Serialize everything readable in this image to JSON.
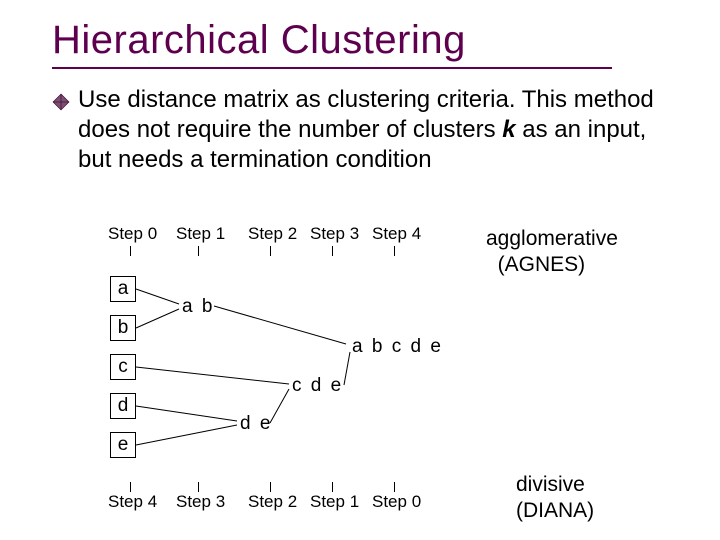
{
  "title": "Hierarchical Clustering",
  "body_pre": "Use distance matrix as clustering criteria.  This method does not require the number of clusters ",
  "body_k": "k",
  "body_post": " as an input, but needs a termination condition",
  "steps_top": {
    "s0": "Step 0",
    "s1": "Step 1",
    "s2": "Step 2",
    "s3": "Step 3",
    "s4": "Step 4"
  },
  "steps_bot": {
    "s0": "Step 4",
    "s1": "Step 3",
    "s2": "Step 2",
    "s3": "Step 1",
    "s4": "Step 0"
  },
  "leaves": {
    "a": "a",
    "b": "b",
    "c": "c",
    "d": "d",
    "e": "e"
  },
  "nodes": {
    "ab": "a b",
    "de": "d e",
    "cde": "c d e",
    "abcde": "a b c d e"
  },
  "algo": {
    "agnes1": "agglomerative",
    "agnes2": "(AGNES)",
    "diana1": "divisive",
    "diana2": "(DIANA)"
  },
  "chart_data": {
    "type": "tree",
    "title": "Hierarchical dendrogram (agglomerative top axis, divisive bottom axis)",
    "leaves": [
      "a",
      "b",
      "c",
      "d",
      "e"
    ],
    "merges": [
      {
        "step": 1,
        "merge": [
          "a",
          "b"
        ],
        "result": "ab"
      },
      {
        "step": 2,
        "merge": [
          "d",
          "e"
        ],
        "result": "de"
      },
      {
        "step": 3,
        "merge": [
          "c",
          "de"
        ],
        "result": "cde"
      },
      {
        "step": 4,
        "merge": [
          "ab",
          "cde"
        ],
        "result": "abcde"
      }
    ],
    "axis_top": [
      "Step 0",
      "Step 1",
      "Step 2",
      "Step 3",
      "Step 4"
    ],
    "axis_bottom": [
      "Step 4",
      "Step 3",
      "Step 2",
      "Step 1",
      "Step 0"
    ],
    "algorithm_top": "agglomerative (AGNES)",
    "algorithm_bottom": "divisive (DIANA)"
  }
}
